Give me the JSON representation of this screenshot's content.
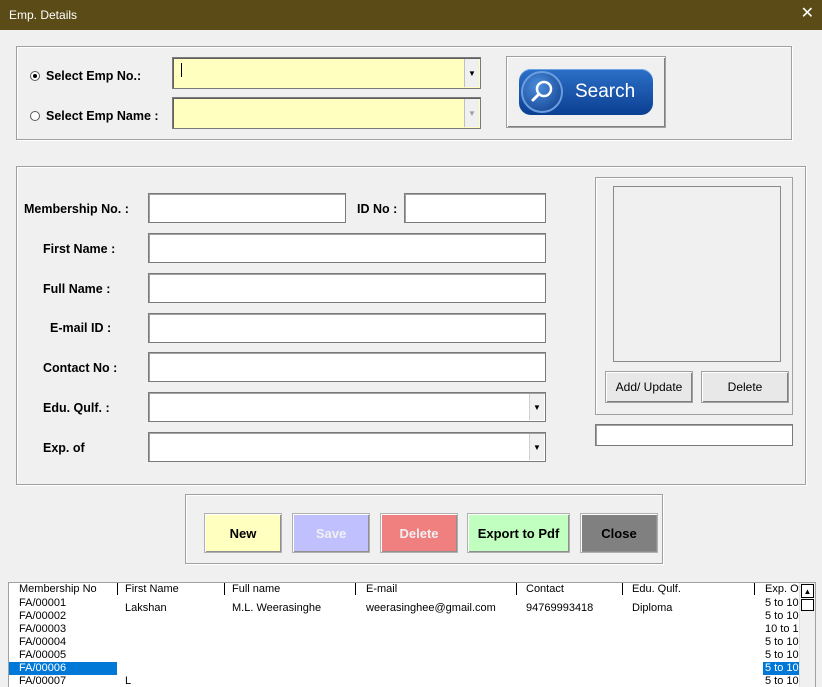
{
  "window": {
    "title": "Emp. Details",
    "close_glyph": "✕"
  },
  "search_panel": {
    "emp_no_label": "Select Emp No.:",
    "emp_name_label": "Select Emp Name :",
    "search_button_label": "Search",
    "emp_no_value": "",
    "emp_name_value": ""
  },
  "form": {
    "membership_label": "Membership No. :",
    "id_label": "ID No :",
    "first_name_label": "First Name :",
    "full_name_label": "Full Name :",
    "email_label": "E-mail ID :",
    "contact_label": "Contact No :",
    "edu_label": "Edu. Qulf. :",
    "exp_label": "Exp. of"
  },
  "photo": {
    "add_update_label": "Add/ Update",
    "delete_label": "Delete"
  },
  "actions": {
    "new_label": "New",
    "save_label": "Save",
    "delete_label": "Delete",
    "export_label": "Export to Pdf",
    "close_label": "Close"
  },
  "table": {
    "columns": [
      "Membership No",
      "First Name",
      "Full name",
      "E-mail",
      "Contact",
      "Edu. Qulf.",
      "Exp. Of"
    ],
    "rows": [
      {
        "membership": "FA/00001",
        "first": "Lakshan",
        "full": "M.L. Weerasinghe",
        "email": "weerasinghee@gmail.com",
        "contact": "94769993418",
        "edu": "Diploma",
        "exp": "5 to 10"
      },
      {
        "membership": "FA/00002",
        "first": "",
        "full": "",
        "email": "",
        "contact": "",
        "edu": "",
        "exp": "5 to 10"
      },
      {
        "membership": "FA/00003",
        "first": "",
        "full": "",
        "email": "",
        "contact": "",
        "edu": "",
        "exp": "10 to 1"
      },
      {
        "membership": "FA/00004",
        "first": "",
        "full": "",
        "email": "",
        "contact": "",
        "edu": "",
        "exp": "5 to 10"
      },
      {
        "membership": "FA/00005",
        "first": "",
        "full": "",
        "email": "",
        "contact": "",
        "edu": "",
        "exp": "5 to 10"
      },
      {
        "membership": "FA/00006",
        "first": "",
        "full": "",
        "email": "",
        "contact": "",
        "edu": "",
        "exp": "5 to 10"
      },
      {
        "membership": "FA/00007",
        "first": "L",
        "full": "",
        "email": "",
        "contact": "",
        "edu": "",
        "exp": "5 to 10"
      }
    ],
    "selected_row": 5
  },
  "colors": {
    "titlebar": "#5b4c17",
    "combo_bg": "#ffffc0",
    "new_bg": "#ffffc0",
    "save_bg": "#c0c0ff",
    "delete_bg": "#f08080",
    "export_bg": "#c0ffc0",
    "close_bg": "#808080",
    "selection": "#0078d7"
  },
  "icons": {
    "search": "magnifier-icon",
    "close": "close-icon",
    "dropdown": "chevron-down-icon",
    "scroll_up": "scroll-up-icon"
  }
}
